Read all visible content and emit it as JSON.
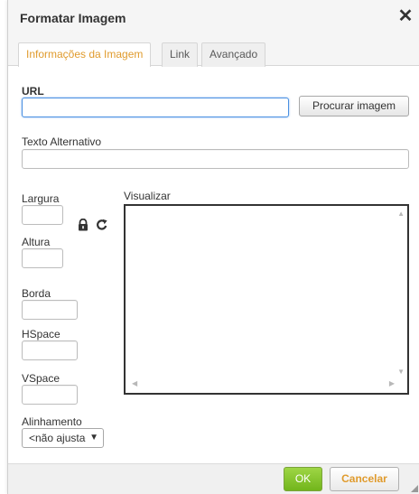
{
  "dialog": {
    "title": "Formatar Imagem",
    "close_glyph": "✕"
  },
  "tabs": [
    {
      "label": "Informações da Imagem",
      "active": true
    },
    {
      "label": "Link",
      "active": false
    },
    {
      "label": "Avançado",
      "active": false
    }
  ],
  "form": {
    "url_label": "URL",
    "url_value": "",
    "browse_button": "Procurar imagem",
    "alt_label": "Texto Alternativo",
    "alt_value": "",
    "width_label": "Largura",
    "height_label": "Altura",
    "preview_label": "Visualizar",
    "border_label": "Borda",
    "hspace_label": "HSpace",
    "vspace_label": "VSpace",
    "align_label": "Alinhamento",
    "align_value": "<não ajustado>"
  },
  "icons": {
    "lock": "lock-icon",
    "reset": "reset-size-icon"
  },
  "footer": {
    "ok_label": "OK",
    "cancel_label": "Cancelar"
  },
  "colors": {
    "accent": "#e09b2d",
    "ok_green": "#72b51c",
    "focus_blue": "#4a90e2"
  }
}
